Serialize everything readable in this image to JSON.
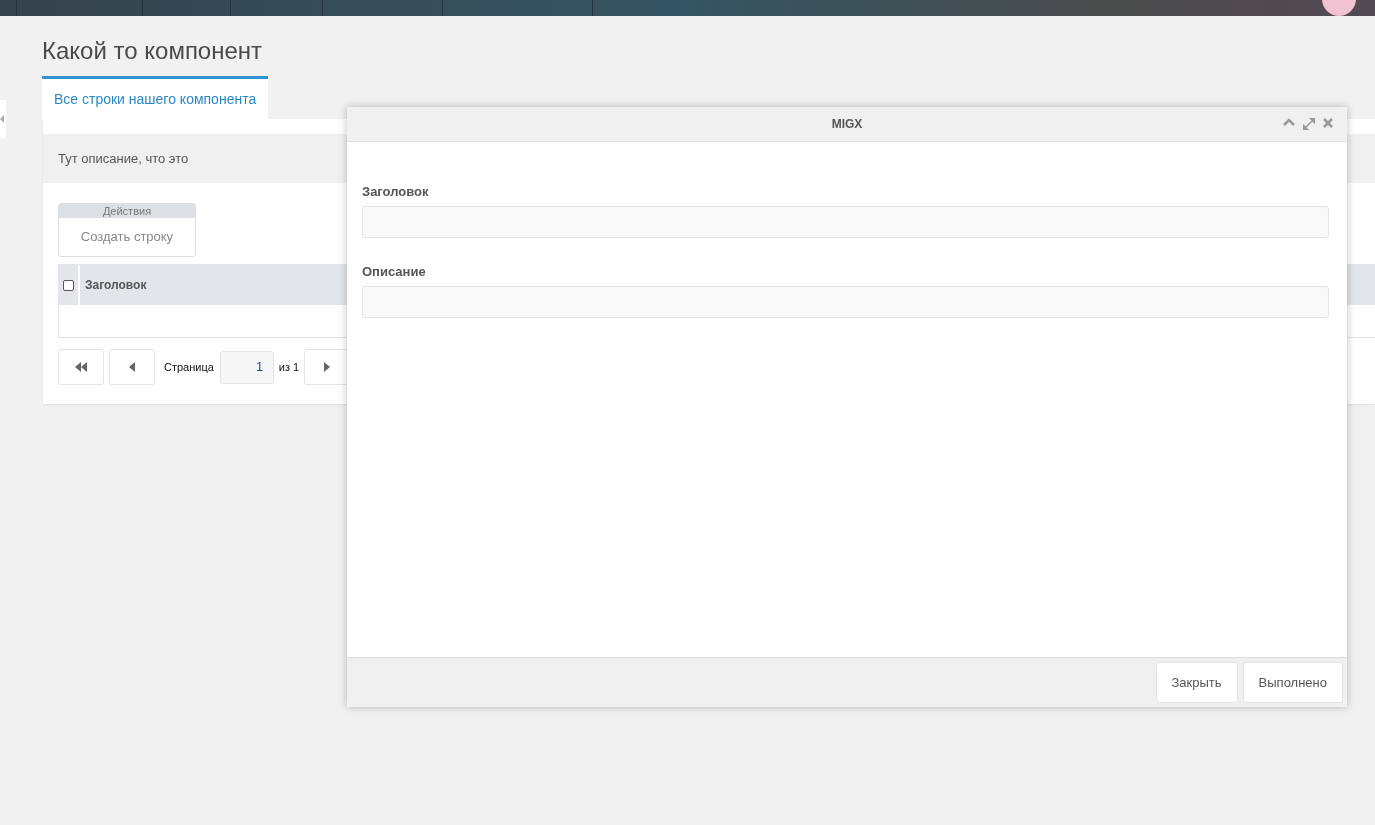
{
  "title": "Какой то компонент",
  "tabs": [
    {
      "label": "Все строки нашего компонента",
      "selected": true
    }
  ],
  "description": "Тут описание, что это",
  "actions": {
    "title": "Действия",
    "buttons": [
      "Создать строку"
    ]
  },
  "grid": {
    "select_all_checked": false,
    "columns": [
      {
        "label": "Заголовок"
      }
    ]
  },
  "pager": {
    "page_label": "Страница",
    "page": "1",
    "of_label": "из 1"
  },
  "modal": {
    "title": "MIGX",
    "fields": [
      {
        "label": "Заголовок"
      },
      {
        "label": "Описание"
      }
    ],
    "buttons": [
      "Закрыть",
      "Выполнено"
    ]
  }
}
